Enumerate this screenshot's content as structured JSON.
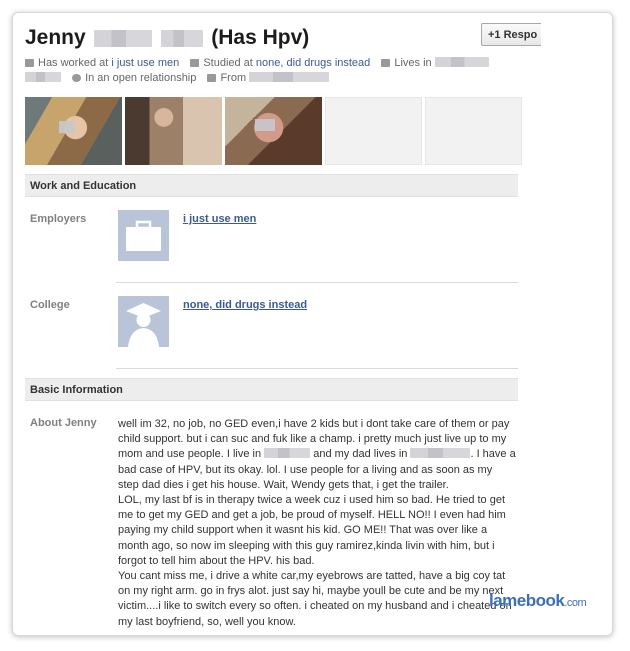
{
  "profile": {
    "first_name": "Jenny",
    "name_suffix": "(Has Hpv)",
    "respond_button": "+1 Respo",
    "meta": {
      "worked_prefix": "Has worked at",
      "worked_at": "i just use men",
      "studied_prefix": "Studied at",
      "studied_at": "none, did drugs instead",
      "lives_prefix": "Lives in",
      "relationship": "In an open relationship",
      "from_prefix": "From"
    }
  },
  "sections": {
    "work_title": "Work and Education",
    "employers_label": "Employers",
    "employer": "i just use men",
    "college_label": "College",
    "college": "none, did drugs instead",
    "basic_title": "Basic Information",
    "about_label": "About Jenny",
    "about": {
      "line1": "well im 32, no job, no GED even,i have 2 kids but i dont take care of them or pay child support. but i can suc and fuk like a champ. i pretty much just live up to my mom and use people. I live in",
      "line2": "and my dad lives in",
      "line3": ". I have a bad case of HPV, but its okay. lol. I use people for a living and as soon as my step dad dies i get his house. Wait, Wendy gets that, i get the trailer.",
      "para2": "LOL, my last bf is in therapy twice a week cuz i used him so bad. He tried to get me to get my GED and get a job, be proud of myself. HELL NO!! I even had him paying my child support when it wasnt his kid. GO ME!! That was over like a month ago, so now im sleeping with this guy ramirez,kinda livin with him, but i forgot to tell him about the HPV. his bad.",
      "para3": "You cant miss me, i drive a white car,my eyebrows are tatted, have a big coy tat on my right arm. go in frys alot. just say hi, maybe youll be cute and be my next victim....i like to switch every so often. i cheated on my husband and i cheated on my last boyfriend, so, well you know."
    }
  },
  "watermark": {
    "main": "lamebook",
    "suffix": ".com"
  }
}
